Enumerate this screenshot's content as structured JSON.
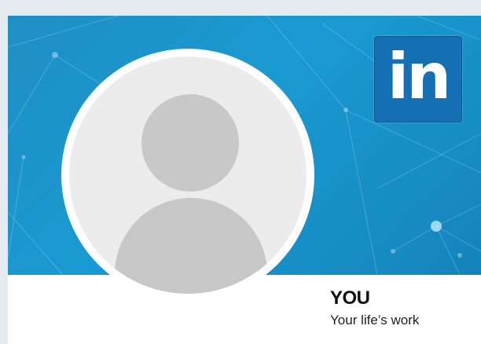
{
  "profile": {
    "name": "YOU",
    "tagline": "Your life’s work"
  },
  "logo": {
    "text": "in",
    "icon": "linkedin-logo-icon"
  },
  "avatar": {
    "icon": "default-user-avatar-icon"
  },
  "colors": {
    "banner": "#1a9ad2",
    "logo_bg": "#1571b3",
    "avatar_bg": "#ececec",
    "avatar_silhouette": "#c8c8c8",
    "page_bg": "#e3ebf1"
  }
}
